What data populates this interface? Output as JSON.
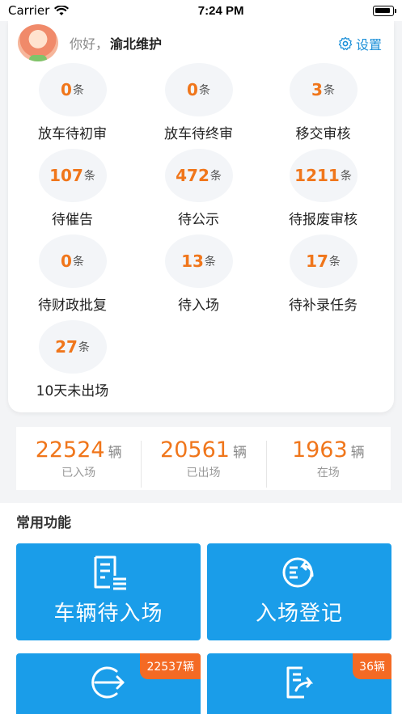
{
  "status_bar": {
    "carrier": "Carrier",
    "time": "7:24 PM"
  },
  "user": {
    "greeting": "你好，",
    "name": "渝北维护",
    "settings_label": "设置"
  },
  "tasks": [
    {
      "count": "0",
      "unit": "条",
      "label": "放车待初审"
    },
    {
      "count": "0",
      "unit": "条",
      "label": "放车待终审"
    },
    {
      "count": "3",
      "unit": "条",
      "label": "移交审核"
    },
    {
      "count": "107",
      "unit": "条",
      "label": "待催告"
    },
    {
      "count": "472",
      "unit": "条",
      "label": "待公示"
    },
    {
      "count": "1211",
      "unit": "条",
      "label": "待报废审核"
    },
    {
      "count": "0",
      "unit": "条",
      "label": "待财政批复"
    },
    {
      "count": "13",
      "unit": "条",
      "label": "待入场"
    },
    {
      "count": "17",
      "unit": "条",
      "label": "待补录任务"
    },
    {
      "count": "27",
      "unit": "条",
      "label": "10天未出场"
    }
  ],
  "stats": [
    {
      "value": "22524",
      "unit": "辆",
      "label": "已入场"
    },
    {
      "value": "20561",
      "unit": "辆",
      "label": "已出场"
    },
    {
      "value": "1963",
      "unit": "辆",
      "label": "在场"
    }
  ],
  "common": {
    "title": "常用功能",
    "tiles": [
      {
        "label": "车辆待入场",
        "icon": "document-list-icon",
        "badge": ""
      },
      {
        "label": "入场登记",
        "icon": "enter-circle-icon",
        "badge": ""
      },
      {
        "label": "",
        "icon": "exit-circle-icon",
        "badge": "22537辆"
      },
      {
        "label": "",
        "icon": "document-share-icon",
        "badge": "36辆"
      }
    ]
  },
  "colors": {
    "accent": "#f0761b",
    "primary": "#1a9de9",
    "badge": "#f46a24",
    "link": "#1a8fd8"
  }
}
